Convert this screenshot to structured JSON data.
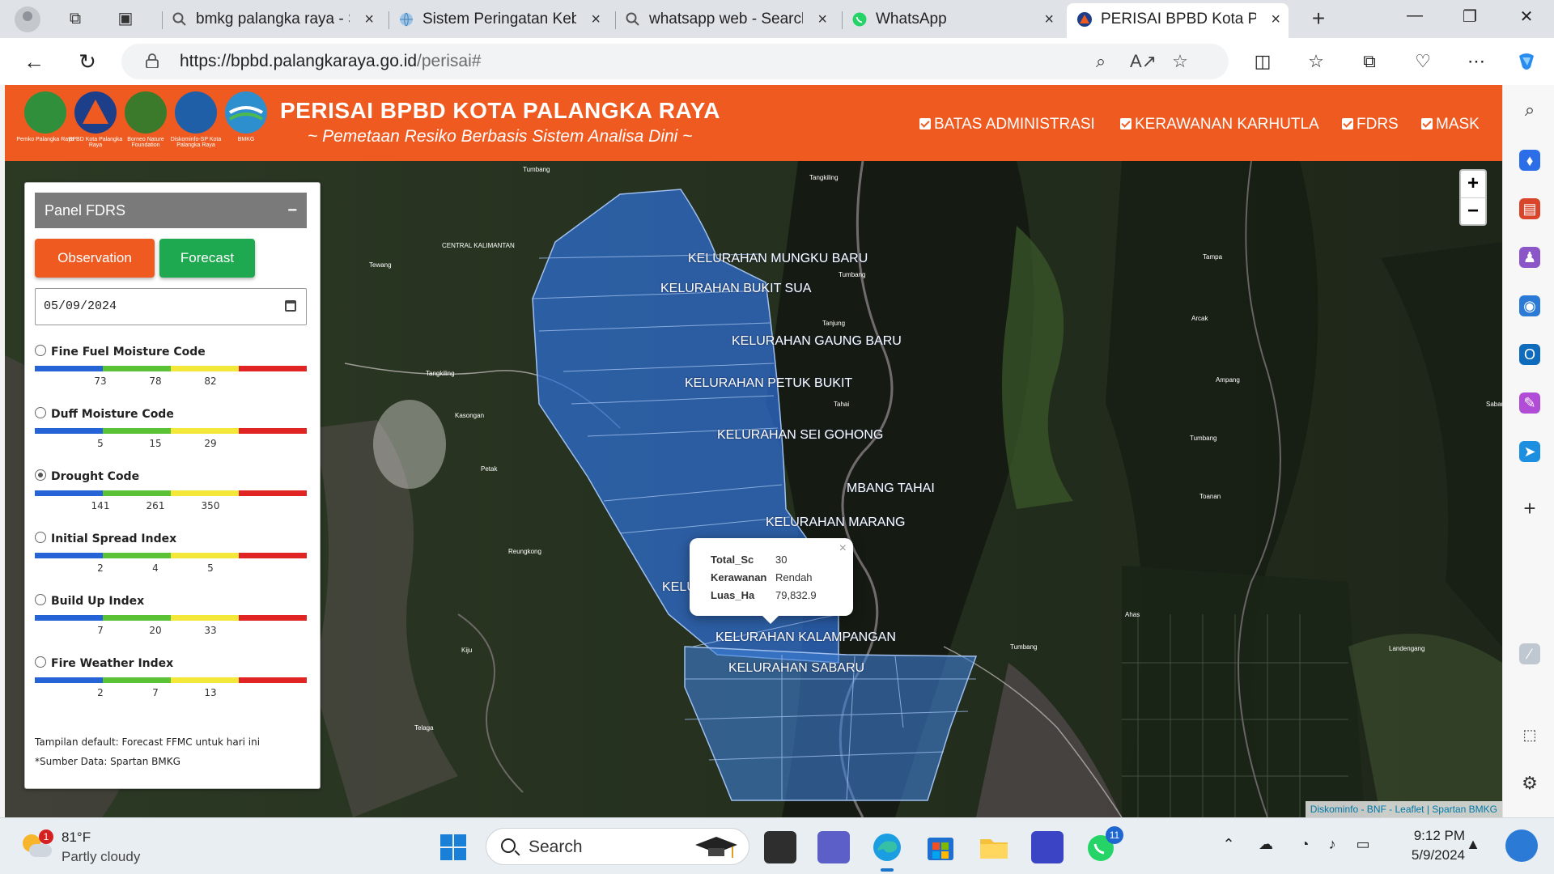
{
  "browser": {
    "tabs": [
      {
        "title": "bmkg palangka raya - Search",
        "icon": "search-icon"
      },
      {
        "title": "Sistem Peringatan Kebakaran",
        "icon": "globe-icon"
      },
      {
        "title": "whatsapp web - Search",
        "icon": "search-icon"
      },
      {
        "title": "WhatsApp",
        "icon": "whatsapp-icon"
      },
      {
        "title": "PERISAI BPBD Kota Palangka Raya",
        "icon": "bpbd-icon"
      }
    ],
    "url_host": "https://bpbd.palangkaraya.go.id",
    "url_path": "/perisai#"
  },
  "header": {
    "title": "PERISAI BPBD KOTA PALANGKA RAYA",
    "subtitle": "~ Pemetaan Resiko Berbasis Sistem Analisa Dini ~",
    "logos": [
      {
        "caption": "Pemko Palangka Raya",
        "color": "#2f8f3a"
      },
      {
        "caption": "BPBD Kota Palangka Raya",
        "color": "#1d3f8a"
      },
      {
        "caption": "Borneo Nature Foundation",
        "color": "#3a7a2a"
      },
      {
        "caption": "Diskominfo-SP Kota Palangka Raya",
        "color": "#1f5fa8"
      },
      {
        "caption": "BMKG",
        "color": "#2e8fcf"
      }
    ],
    "layers": [
      "BATAS ADMINISTRASI",
      "KERAWANAN KARHUTLA",
      "FDRS",
      "MASK"
    ]
  },
  "map": {
    "labels": [
      "KELURAHAN MUNGKU BARU",
      "KELURAHAN BUKIT SUA",
      "KELURAHAN GAUNG BARU",
      "KELURAHAN PETUK BUKIT",
      "KELURAHAN SEI GOHONG",
      "MBANG TAHAI",
      "KELURAHAN MARANG",
      "KELURAHAN PALANGKA",
      "KELURAHAN KALAMPANGAN",
      "KELURAHAN SABARU"
    ],
    "towns": [
      "Tumbang",
      "Tangkiling",
      "CENTRAL KALIMANTAN",
      "Tewang",
      "Tumbang",
      "Tanjung",
      "Tampa",
      "Arcak",
      "Ampang",
      "Sabau",
      "Tangkiling",
      "Kasongan",
      "Petak",
      "Tumbang",
      "Toanan",
      "Tahai",
      "Reungkong",
      "Kiju",
      "Ahas",
      "Telaga",
      "Tumbang",
      "Landengang"
    ],
    "zoom_in": "+",
    "zoom_out": "−",
    "attribution": "Diskominfo - BNF - Leaflet | Spartan BMKG",
    "popup": {
      "rows": [
        {
          "key": "Total_Sc",
          "value": "30"
        },
        {
          "key": "Kerawanan",
          "value": "Rendah"
        },
        {
          "key": "Luas_Ha",
          "value": "79,832.9"
        }
      ],
      "close": "×"
    }
  },
  "panel": {
    "title": "Panel FDRS",
    "minimize": "−",
    "observation_label": "Observation",
    "forecast_label": "Forecast",
    "date_value": "05/09/2024",
    "indices": [
      {
        "name": "Fine Fuel Moisture Code",
        "ticks": [
          "73",
          "78",
          "82"
        ],
        "selected": false
      },
      {
        "name": "Duff Moisture Code",
        "ticks": [
          "5",
          "15",
          "29"
        ],
        "selected": false
      },
      {
        "name": "Drought Code",
        "ticks": [
          "141",
          "261",
          "350"
        ],
        "selected": true
      },
      {
        "name": "Initial Spread Index",
        "ticks": [
          "2",
          "4",
          "5"
        ],
        "selected": false
      },
      {
        "name": "Build Up Index",
        "ticks": [
          "7",
          "20",
          "33"
        ],
        "selected": false
      },
      {
        "name": "Fire Weather Index",
        "ticks": [
          "2",
          "7",
          "13"
        ],
        "selected": false
      }
    ],
    "scale_colors": [
      "#2563d6",
      "#5bc236",
      "#f3e83a",
      "#e02424"
    ],
    "note": "Tampilan default: Forecast FFMC untuk hari ini",
    "source": "*Sumber Data: Spartan BMKG"
  },
  "taskbar": {
    "weather_temp": "81°F",
    "weather_desc": "Partly cloudy",
    "weather_badge": "1",
    "search_label": "Search",
    "whatsapp_badge": "11",
    "time": "9:12 PM",
    "date": "5/9/2024"
  },
  "colors": {
    "brand": "#ef5a20",
    "forecast": "#1ea84f",
    "polygon": "#2f6fd6"
  }
}
